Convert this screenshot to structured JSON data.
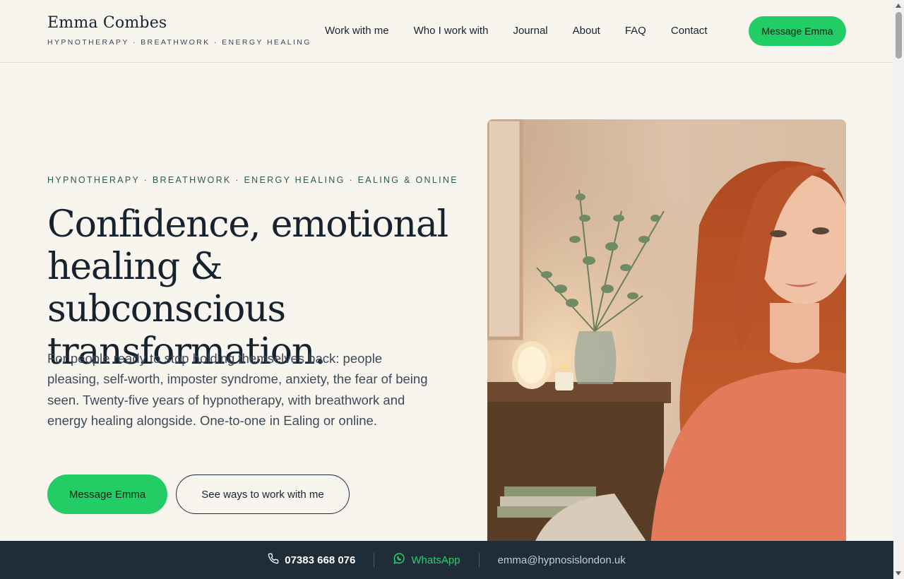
{
  "header": {
    "brand_name": "Emma Combes",
    "brand_tagline": "HYPNOTHERAPY · BREATHWORK · ENERGY HEALING",
    "nav": [
      "Work with me",
      "Who I work with",
      "Journal",
      "About",
      "FAQ",
      "Contact"
    ],
    "cta_label": "Message Emma"
  },
  "hero": {
    "eyebrow": "HYPNOTHERAPY · BREATHWORK · ENERGY HEALING · EALING & ONLINE",
    "title": "Confidence, emotional healing & subconscious transformation.",
    "body": "For people ready to stop holding themselves back: people pleasing, self-worth, imposter syndrome, anxiety, the fear of being seen. Twenty-five years of hypnotherapy, with breathwork and energy healing alongside. One-to-one in Ealing or online.",
    "primary_button": "Message Emma",
    "secondary_button": "See ways to work with me"
  },
  "contact_bar": {
    "phone": "07383 668 076",
    "whatsapp": "WhatsApp",
    "email": "emma@hypnosislondon.uk"
  },
  "colors": {
    "background": "#f8f5ef",
    "accent_green": "#22cd65",
    "dark_navy": "#1f2d38",
    "ink": "#16222e"
  },
  "icons": {
    "phone": "phone-icon",
    "whatsapp": "whatsapp-icon"
  }
}
